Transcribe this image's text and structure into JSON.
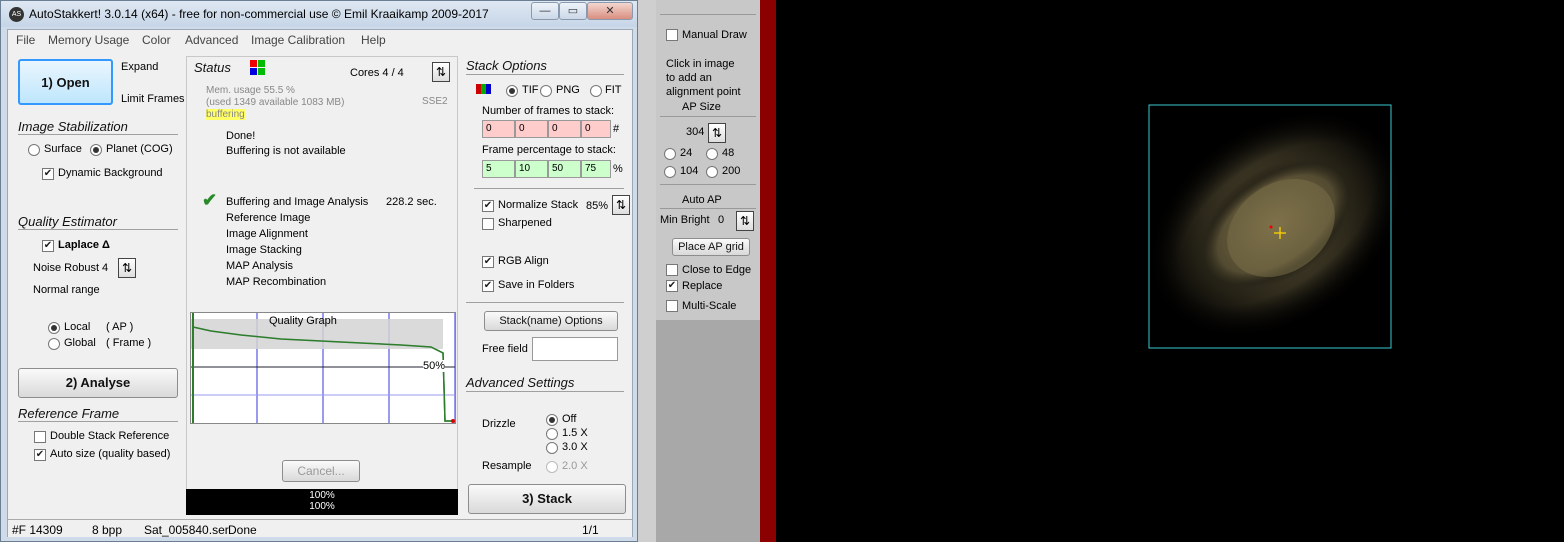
{
  "window": {
    "title": "AutoStakkert! 3.0.14 (x64) - free for non-commercial use © Emil Kraaikamp 2009-2017",
    "icon": "app-icon",
    "controls": [
      "—",
      "▭",
      "✕"
    ]
  },
  "menu": [
    "File",
    "Memory Usage",
    "Color",
    "Advanced",
    "Image Calibration",
    "Help"
  ],
  "left": {
    "open_button": "1) Open",
    "expand": "Expand",
    "limit_frames": "Limit Frames",
    "stabilization_header": "Image Stabilization",
    "surface": "Surface",
    "planet": "Planet (COG)",
    "dynamic_bg": "Dynamic Background",
    "quality_header": "Quality Estimator",
    "laplace": "Laplace Δ",
    "noise_robust": "Noise Robust",
    "noise_value": "4",
    "normal_range": "Normal range",
    "local": "Local",
    "local_ap": "( AP )",
    "global": "Global",
    "global_frame": "( Frame )",
    "analyse_button": "2) Analyse",
    "reference_header": "Reference Frame",
    "double_stack": "Double Stack Reference",
    "auto_size": "Auto size (quality based)"
  },
  "status": {
    "header": "Status",
    "cores": "Cores 4 / 4",
    "mem_usage": "Mem. usage 55.5 %",
    "mem_detail": "(used 1349 available 1083 MB)",
    "sse": "SSE2",
    "buffering_label": "buffering",
    "done": "Done!",
    "buffer_msg": "Buffering is not available",
    "steps": [
      "Buffering and Image Analysis",
      "Reference Image",
      "Image Alignment",
      "Image Stacking",
      "MAP Analysis",
      "MAP Recombination"
    ],
    "step_time": "228.2 sec.",
    "graph_title": "Quality Graph",
    "graph_marker": "50%",
    "cancel": "Cancel...",
    "progress1": "100%",
    "progress2": "100%"
  },
  "stack": {
    "header": "Stack Options",
    "tif": "TIF",
    "png": "PNG",
    "fit": "FIT",
    "num_frames_label": "Number of frames to stack:",
    "num_frames": [
      "0",
      "0",
      "0",
      "0"
    ],
    "num_suffix": "#",
    "pct_label": "Frame percentage to stack:",
    "pct": [
      "5",
      "10",
      "50",
      "75"
    ],
    "pct_suffix": "%",
    "normalize": "Normalize Stack",
    "normalize_pct": "85%",
    "sharpened": "Sharpened",
    "rgb_align": "RGB Align",
    "save_folders": "Save in Folders",
    "stackname_btn": "Stack(name) Options",
    "free_field": "Free field",
    "adv_header": "Advanced Settings",
    "drizzle": "Drizzle",
    "off": "Off",
    "d15": "1.5 X",
    "d30": "3.0 X",
    "resample": "Resample",
    "r20": "2.0 X",
    "stack_button": "3) Stack"
  },
  "statusbar": {
    "frames": "#F 14309",
    "bpp": "8 bpp",
    "file": "Sat_005840.ser",
    "state": "Done",
    "page": "1/1"
  },
  "side": {
    "manual_draw": "Manual Draw",
    "hint1": "Click in image",
    "hint2": "to add an",
    "hint3": "alignment point",
    "ap_size": "AP Size",
    "ap_value": "304",
    "sizes": [
      "24",
      "48",
      "104",
      "200"
    ],
    "auto_ap": "Auto AP",
    "min_bright": "Min Bright",
    "min_value": "0",
    "place_grid": "Place AP grid",
    "close_edge": "Close to Edge",
    "replace": "Replace",
    "multi_scale": "Multi-Scale"
  },
  "colors": {
    "accent": "#3399ff",
    "green_box": "#ccffcc",
    "red_box": "#ffcccc",
    "roi": "#38c8d0"
  }
}
